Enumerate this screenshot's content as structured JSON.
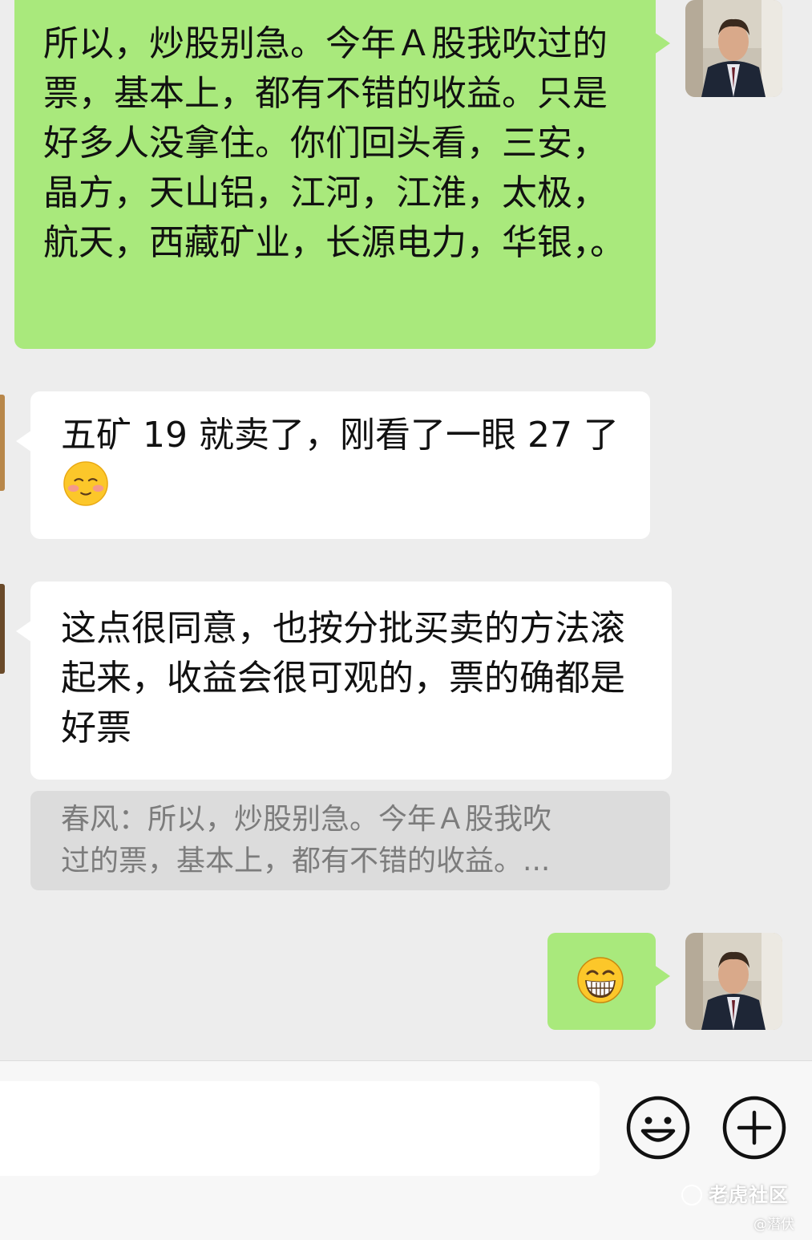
{
  "messages": [
    {
      "side": "right",
      "text": "所以，炒股别急。今年Ａ股我吹过的票，基本上，都有不错的收益。只是好多人没拿住。你们回头看，三安，晶方，天山铝，江河，江淮，太极，航天，西藏矿业，长源电力，华银，。"
    },
    {
      "side": "left",
      "text": "五矿 19 就卖了，刚看了一眼 27 了",
      "emoji": "blush-emoji"
    },
    {
      "side": "left",
      "text": "这点很同意，也按分批买卖的方法滚起来，收益会很可观的，票的确都是好票",
      "quote": {
        "line1": "春风：所以，炒股别急。今年Ａ股我吹",
        "line2": "过的票，基本上，都有不错的收益。..."
      }
    },
    {
      "side": "right",
      "emoji": "grin-emoji"
    }
  ],
  "input_bar": {
    "icons": [
      "smiley-icon",
      "plus-icon"
    ]
  },
  "watermark": {
    "brand": "老虎社区",
    "user": "@潜伏"
  }
}
